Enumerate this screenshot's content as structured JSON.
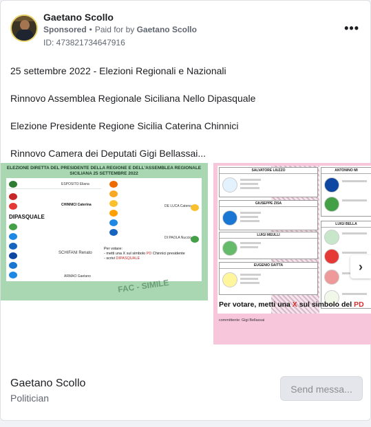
{
  "post": {
    "author": "Gaetano Scollo",
    "sponsored_label": "Sponsored",
    "paid_for_prefix": "Paid for by",
    "paid_for_name": "Gaetano Scollo",
    "ad_id": "ID: 473821734647916",
    "more_icon": "•••"
  },
  "text_lines": [
    "25 settembre 2022 - Elezioni Regionali e Nazionali",
    "Rinnovo Assemblea Regionale Siciliana Nello Dipasquale",
    "Elezione Presidente Regione Sicilia Caterina Chinnici",
    "Rinnovo Camera dei Deputati Gigi Bellassai..."
  ],
  "slide1": {
    "title": "ELEZIONE DIRETTA DEL PRESIDENTE DELLA REGIONE E DELL'ASSEMBLEA REGIONALE SICILIANA 25 SETTEMBRE 2022",
    "candidate_esposito": "ESPOSITO Eliana",
    "candidate_chinnici": "CHINNICI Caterina",
    "candidate_delucia": "DE LUCA Cateno",
    "candidate_schifani": "SCHIFANI Renato",
    "candidate_dipaola": "DI PAOLA Nuccio",
    "candidate_armao": "ARMAO Gaetano",
    "dipasquale_label": "DIPASQUALE",
    "notes_title": "Per votare:",
    "notes_line1_a": "- metti una X sul simbolo ",
    "notes_line1_b": "PD",
    "notes_line1_c": " Chinnici presidente",
    "notes_line2_a": "- scrivi ",
    "notes_line2_b": "DIPASQUALE",
    "watermark": "FAC - SIMILE"
  },
  "slide2": {
    "block1": "SALVATORE LIUZZO",
    "block2": "GIUSEPPE ZISA",
    "block3": "LUIGI MEULLI",
    "block4": "EUGENIO SAITTA",
    "block5": "ANTONINO MI",
    "block6": "LUIGI BELLA",
    "vote_a": "Per votare, metti una ",
    "vote_x": "X",
    "vote_b": " sul simbolo del ",
    "vote_pd": "PD",
    "committente": "committente: Gigi Bellassai"
  },
  "carousel_next_icon": "›",
  "footer": {
    "page_name": "Gaetano Scollo",
    "category": "Politician",
    "send_button": "Send messa..."
  },
  "colors": {
    "slide1_bg": "#a8d7b1",
    "slide2_bg": "#f7c6db",
    "accent_red": "#d32f2f"
  }
}
